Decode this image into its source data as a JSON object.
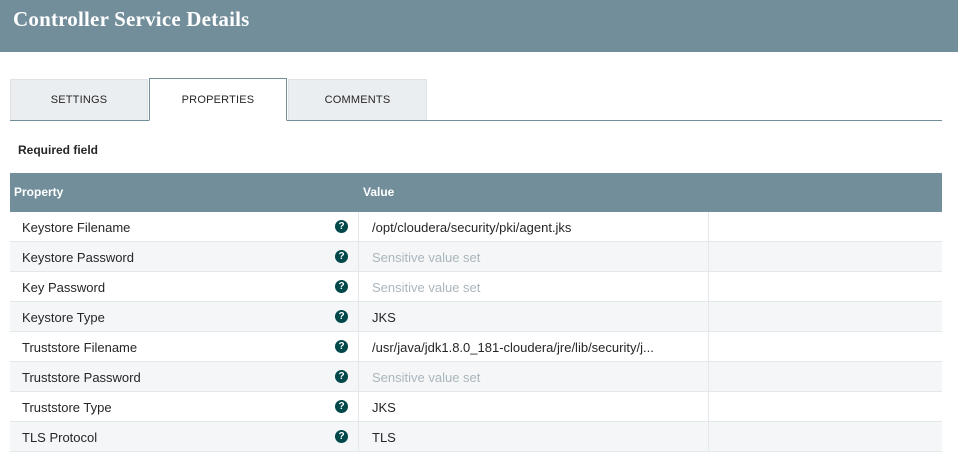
{
  "header": {
    "title": "Controller Service Details"
  },
  "tabs": [
    {
      "label": "SETTINGS",
      "active": false
    },
    {
      "label": "PROPERTIES",
      "active": true
    },
    {
      "label": "COMMENTS",
      "active": false
    }
  ],
  "required_label": "Required field",
  "table": {
    "headers": {
      "property": "Property",
      "value": "Value"
    },
    "rows": [
      {
        "name": "Keystore Filename",
        "value": "/opt/cloudera/security/pki/agent.jks",
        "sensitive": false
      },
      {
        "name": "Keystore Password",
        "value": "Sensitive value set",
        "sensitive": true
      },
      {
        "name": "Key Password",
        "value": "Sensitive value set",
        "sensitive": true
      },
      {
        "name": "Keystore Type",
        "value": "JKS",
        "sensitive": false
      },
      {
        "name": "Truststore Filename",
        "value": "/usr/java/jdk1.8.0_181-cloudera/jre/lib/security/j...",
        "sensitive": false
      },
      {
        "name": "Truststore Password",
        "value": "Sensitive value set",
        "sensitive": true
      },
      {
        "name": "Truststore Type",
        "value": "JKS",
        "sensitive": false
      },
      {
        "name": "TLS Protocol",
        "value": "TLS",
        "sensitive": false
      }
    ]
  },
  "icons": {
    "help": "question-circle-icon",
    "help_glyph": "?"
  },
  "colors": {
    "header_bg": "#728e9b",
    "help_icon": "#004849",
    "sensitive_text": "#aab6bd"
  }
}
